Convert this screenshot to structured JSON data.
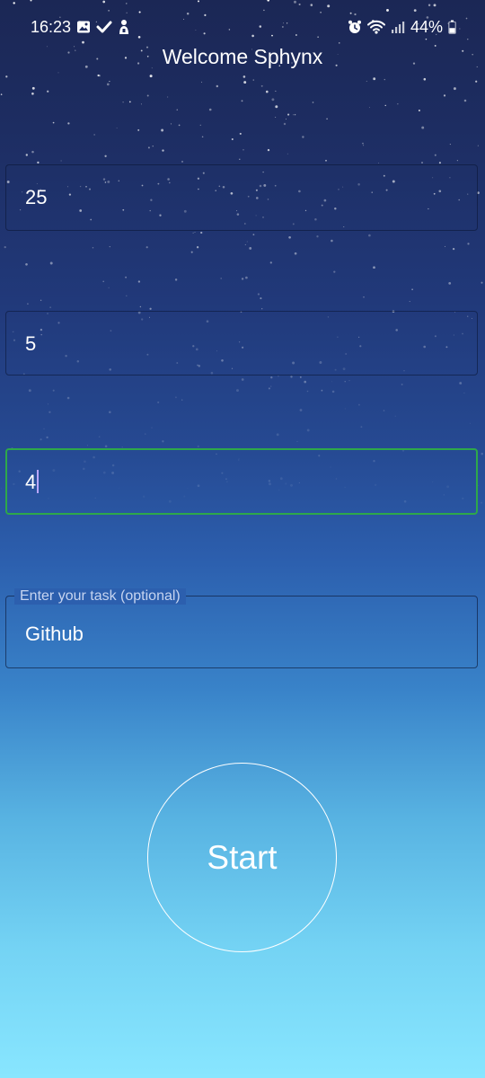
{
  "status_bar": {
    "time": "16:23",
    "left_icons": [
      "image-icon",
      "check-icon",
      "notification-icon"
    ],
    "right_icons": [
      "alarm-icon",
      "wifi-icon",
      "signal-icon",
      "battery-icon"
    ],
    "battery": "44%",
    "battery_level": 0.44
  },
  "header": {
    "title": "Welcome Sphynx"
  },
  "fields": {
    "first_value": "25",
    "second_value": "5",
    "third_value": "4",
    "task_label": "Enter your task (optional)",
    "task_value": "Github"
  },
  "start_button": {
    "label": "Start"
  },
  "colors": {
    "focus_border": "#2ea84a",
    "text": "#ffffff",
    "gradient_top": "#1b2755",
    "gradient_bottom": "#88e6ff"
  }
}
